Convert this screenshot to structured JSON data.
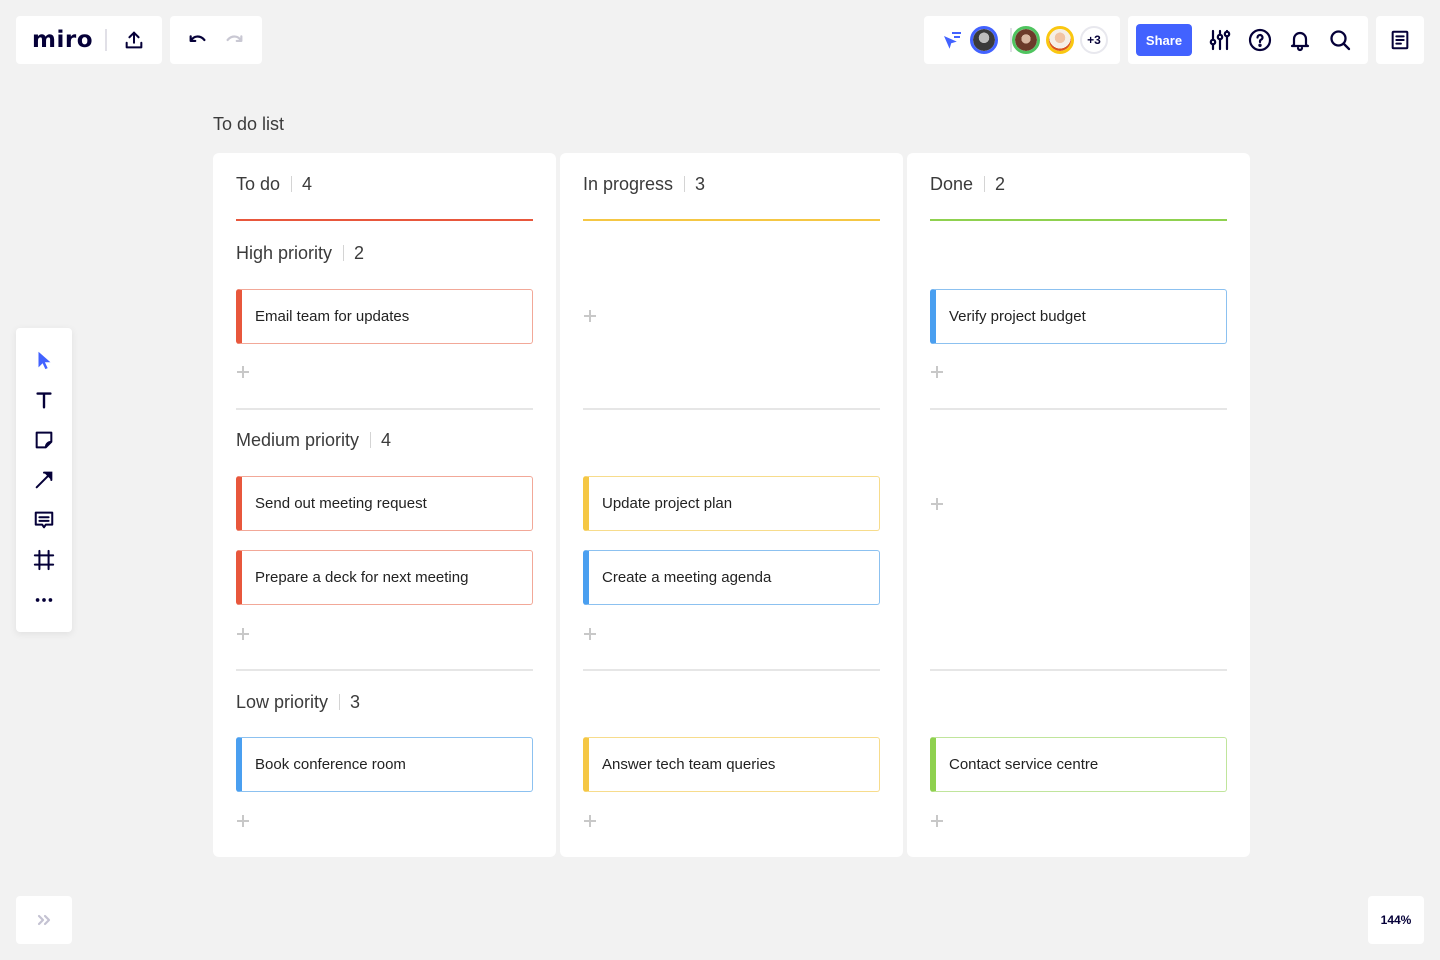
{
  "app": {
    "logo": "miro"
  },
  "toolbar_top": {
    "export_icon": "upload-icon",
    "undo_icon": "undo-icon",
    "redo_icon": "redo-icon"
  },
  "collaboration": {
    "cursor_icon": "cursor-follow-icon",
    "avatars": [
      {
        "name": "user-1",
        "ring_color": "#4262ff"
      },
      {
        "name": "user-2",
        "ring_color": "#4fc45f"
      },
      {
        "name": "user-3",
        "ring_color": "#fac710"
      }
    ],
    "more_users": "+3"
  },
  "toolbar_right": {
    "share_label": "Share",
    "icons": [
      "settings-sliders-icon",
      "help-icon",
      "bell-icon",
      "search-icon"
    ],
    "notes_icon": "notes-icon"
  },
  "left_toolbar": {
    "tools": [
      "select",
      "text",
      "sticky-note",
      "connection-line",
      "comment",
      "frame",
      "more"
    ]
  },
  "bottom": {
    "expand_icon": "chevrons-right-icon",
    "zoom_level": "144%"
  },
  "colors": {
    "accent": "#4262ff",
    "red": "#e8573c",
    "yellow": "#f5c744",
    "green": "#8fd14f",
    "blue": "#4a9ff0"
  },
  "board": {
    "title": "To do list",
    "columns": [
      {
        "title": "To do",
        "count": "4",
        "color": "#e8573c"
      },
      {
        "title": "In progress",
        "count": "3",
        "color": "#f5c744"
      },
      {
        "title": "Done",
        "count": "2",
        "color": "#8fd14f"
      }
    ],
    "rows": [
      {
        "title": "High priority",
        "count": "2"
      },
      {
        "title": "Medium priority",
        "count": "4"
      },
      {
        "title": "Low priority",
        "count": "3"
      }
    ],
    "cards": {
      "todo_high": [
        {
          "text": "Email team for updates",
          "color": "red"
        }
      ],
      "progress_high": [],
      "done_high": [
        {
          "text": "Verify project budget",
          "color": "blue"
        }
      ],
      "todo_medium": [
        {
          "text": "Send out meeting request",
          "color": "red"
        },
        {
          "text": "Prepare a deck for next meeting",
          "color": "red"
        }
      ],
      "progress_medium": [
        {
          "text": "Update project plan",
          "color": "yellow"
        },
        {
          "text": "Create a meeting agenda",
          "color": "blue"
        }
      ],
      "done_medium": [],
      "todo_low": [
        {
          "text": "Book conference room",
          "color": "blue"
        }
      ],
      "progress_low": [
        {
          "text": "Answer tech team queries",
          "color": "yellow"
        }
      ],
      "done_low": [
        {
          "text": "Contact service centre",
          "color": "green"
        }
      ]
    }
  }
}
